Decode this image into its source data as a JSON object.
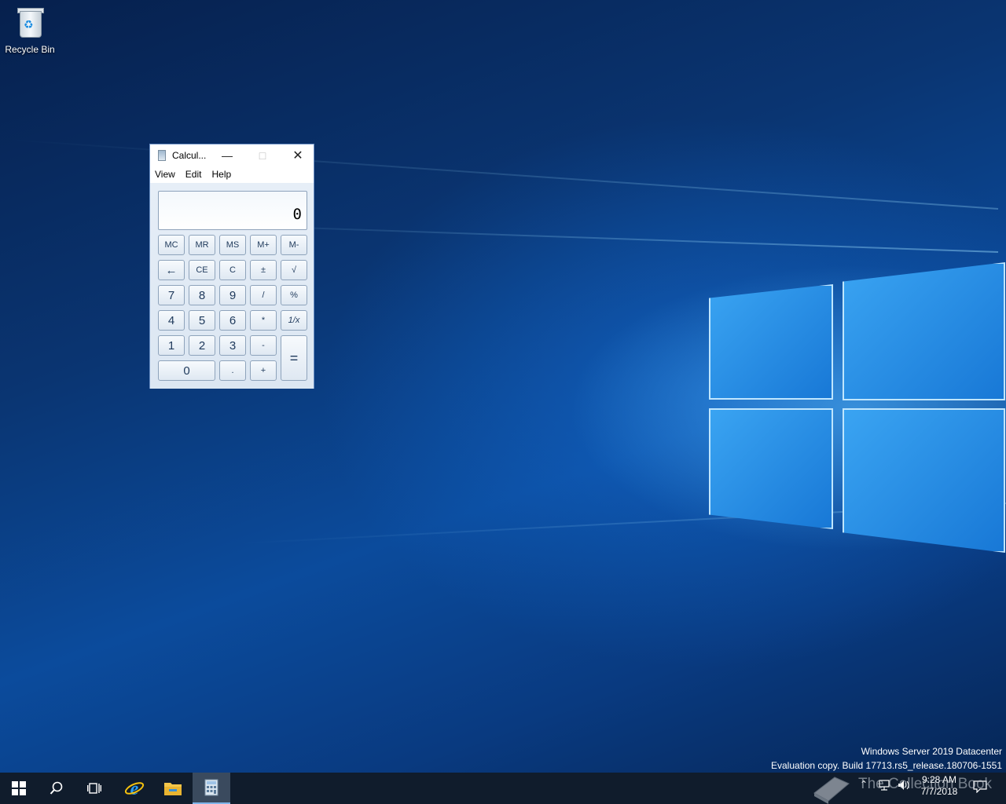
{
  "desktop": {
    "icons": [
      {
        "label": "Recycle Bin",
        "icon": "recycle-bin-icon"
      }
    ],
    "watermark": {
      "line1": "Windows Server 2019 Datacenter",
      "line2": "Evaluation copy. Build 17713.rs5_release.180706-1551"
    },
    "overlay_watermark": "The Collection Book"
  },
  "calculator": {
    "title": "Calcul...",
    "menu": [
      "View",
      "Edit",
      "Help"
    ],
    "display": "0",
    "memory_row": [
      "MC",
      "MR",
      "MS",
      "M+",
      "M-"
    ],
    "row2": [
      "←",
      "CE",
      "C",
      "±",
      "√"
    ],
    "row3": [
      "7",
      "8",
      "9",
      "/",
      "%"
    ],
    "row4": [
      "4",
      "5",
      "6",
      "*",
      "1/x"
    ],
    "row5": [
      "1",
      "2",
      "3",
      "-"
    ],
    "row6": [
      "0",
      ".",
      "+"
    ],
    "equals": "="
  },
  "taskbar": {
    "items": [
      "start-icon",
      "search-icon",
      "task-view-icon",
      "internet-explorer-icon",
      "file-explorer-icon",
      "calculator-icon"
    ],
    "active_item": "calculator-icon",
    "clock": {
      "time": "9:28 AM",
      "date": "7/7/2018"
    }
  },
  "colors": {
    "taskbar": "#101c2c",
    "accent": "#7fb4e8"
  }
}
